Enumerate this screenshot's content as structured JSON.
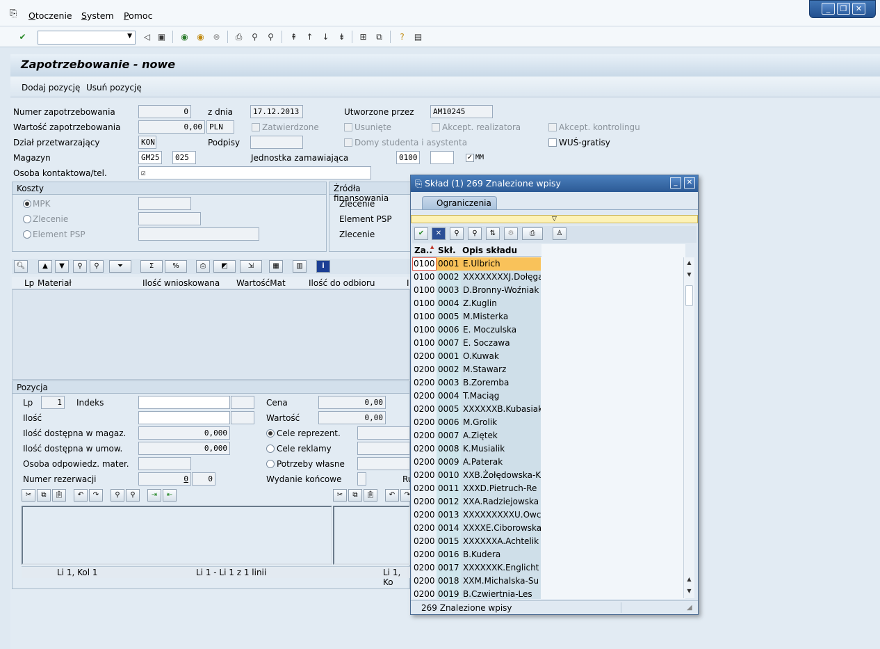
{
  "menu": {
    "items": [
      "Otoczenie",
      "System",
      "Pomoc"
    ]
  },
  "window_controls": {
    "minimize": "_",
    "restore": "❐",
    "close": "✕"
  },
  "title": "Zapotrzebowanie - nowe",
  "app_toolbar": {
    "add": "Dodaj pozycję",
    "remove": "Usuń pozycję"
  },
  "header": {
    "number_label": "Numer zapotrzebowania",
    "number": "0",
    "date_label": "z dnia",
    "date": "17.12.2013",
    "created_by_label": "Utworzone przez",
    "created_by": "AM10245",
    "value_label": "Wartość zapotrzebowania",
    "value": "0,00",
    "currency": "PLN",
    "approved_label": "Zatwierdzone",
    "deleted_label": "Usunięte",
    "accept_real_label": "Akcept. realizatora",
    "accept_ctrl_label": "Akcept. kontrolingu",
    "dept_label": "Dział przetwarzający",
    "dept": "KON",
    "signatures_label": "Podpisy",
    "dorms_label": "Domy studenta i asystenta",
    "wus_label": "WUŚ-gratisy",
    "warehouse_label": "Magazyn",
    "warehouse": "GM25",
    "warehouse2": "025",
    "ordering_unit_label": "Jednostka zamawiająca",
    "ordering_unit": "0100",
    "mm_label": "MM",
    "mm_checked": "✓",
    "contact_label": "Osoba kontaktowa/tel.",
    "contact_icon": "☑"
  },
  "costs": {
    "title": "Koszty",
    "mpk": "MPK",
    "order": "Zlecenie",
    "psp": "Element PSP"
  },
  "funding": {
    "title": "Źródła finansowania",
    "order": "Zlecenie",
    "psp": "Element PSP",
    "order2": "Zlecenie"
  },
  "items_table": {
    "columns": [
      "Lp",
      "Materiał",
      "Ilość wnioskowana",
      "WartośćMat",
      "Ilość do odbioru",
      "I"
    ]
  },
  "position": {
    "title": "Pozycja",
    "lp_label": "Lp",
    "lp": "1",
    "index_label": "Indeks",
    "price_label": "Cena",
    "price": "0,00",
    "qty_label": "Ilość",
    "value_label": "Wartość",
    "value": "0,00",
    "avail_wh_label": "Ilość dostępna w magaz.",
    "avail_wh": "0,000",
    "avail_ct_label": "Ilość dostępna w umow.",
    "avail_ct": "0,000",
    "resp_label": "Osoba odpowiedz. mater.",
    "reserv_label": "Numer rezerwacji",
    "reserv1": "0",
    "reserv2": "0",
    "repr_label": "Cele reprezent.",
    "ads_label": "Cele reklamy",
    "own_label": "Potrzeby własne",
    "final_label": "Wydanie końcowe",
    "ru_label": "Ru",
    "status_left": "Li 1, Kol 1",
    "status_mid": "Li 1 - Li 1 z 1 linii",
    "status_right": "Li 1, Ko"
  },
  "popup": {
    "title": "Skład (1)  269 Znalezione wpisy",
    "tab": "Ograniczenia",
    "columns": [
      "Za..",
      "Skł.",
      "Opis składu"
    ],
    "rows": [
      [
        "0100",
        "0001",
        "E.Ulbrich"
      ],
      [
        "0100",
        "0002",
        "XXXXXXXXJ.Dołęga"
      ],
      [
        "0100",
        "0003",
        "D.Bronny-Woźniak"
      ],
      [
        "0100",
        "0004",
        "Z.Kuglin"
      ],
      [
        "0100",
        "0005",
        "M.Misterka"
      ],
      [
        "0100",
        "0006",
        "E. Moczulska"
      ],
      [
        "0100",
        "0007",
        "E. Soczawa"
      ],
      [
        "0200",
        "0001",
        "O.Kuwak"
      ],
      [
        "0200",
        "0002",
        "M.Stawarz"
      ],
      [
        "0200",
        "0003",
        "B.Zoremba"
      ],
      [
        "0200",
        "0004",
        "T.Maciąg"
      ],
      [
        "0200",
        "0005",
        "XXXXXXB.Kubasiak"
      ],
      [
        "0200",
        "0006",
        "M.Grolik"
      ],
      [
        "0200",
        "0007",
        "A.Ziętek"
      ],
      [
        "0200",
        "0008",
        "K.Musialik"
      ],
      [
        "0200",
        "0009",
        "A.Paterak"
      ],
      [
        "0200",
        "0010",
        "XXB.Żołędowska-K"
      ],
      [
        "0200",
        "0011",
        "XXXD.Pietruch-Re"
      ],
      [
        "0200",
        "0012",
        "XXA.Radziejowska"
      ],
      [
        "0200",
        "0013",
        "XXXXXXXXXU.Owca"
      ],
      [
        "0200",
        "0014",
        "XXXXE.Ciborowska"
      ],
      [
        "0200",
        "0015",
        "XXXXXXA.Achtelik"
      ],
      [
        "0200",
        "0016",
        "B.Kudera"
      ],
      [
        "0200",
        "0017",
        "XXXXXXK.Englicht"
      ],
      [
        "0200",
        "0018",
        "XXM.Michalska-Su"
      ],
      [
        "0200",
        "0019",
        "B.Czwiertnia-Les"
      ]
    ],
    "status": "269 Znalezione wpisy"
  }
}
